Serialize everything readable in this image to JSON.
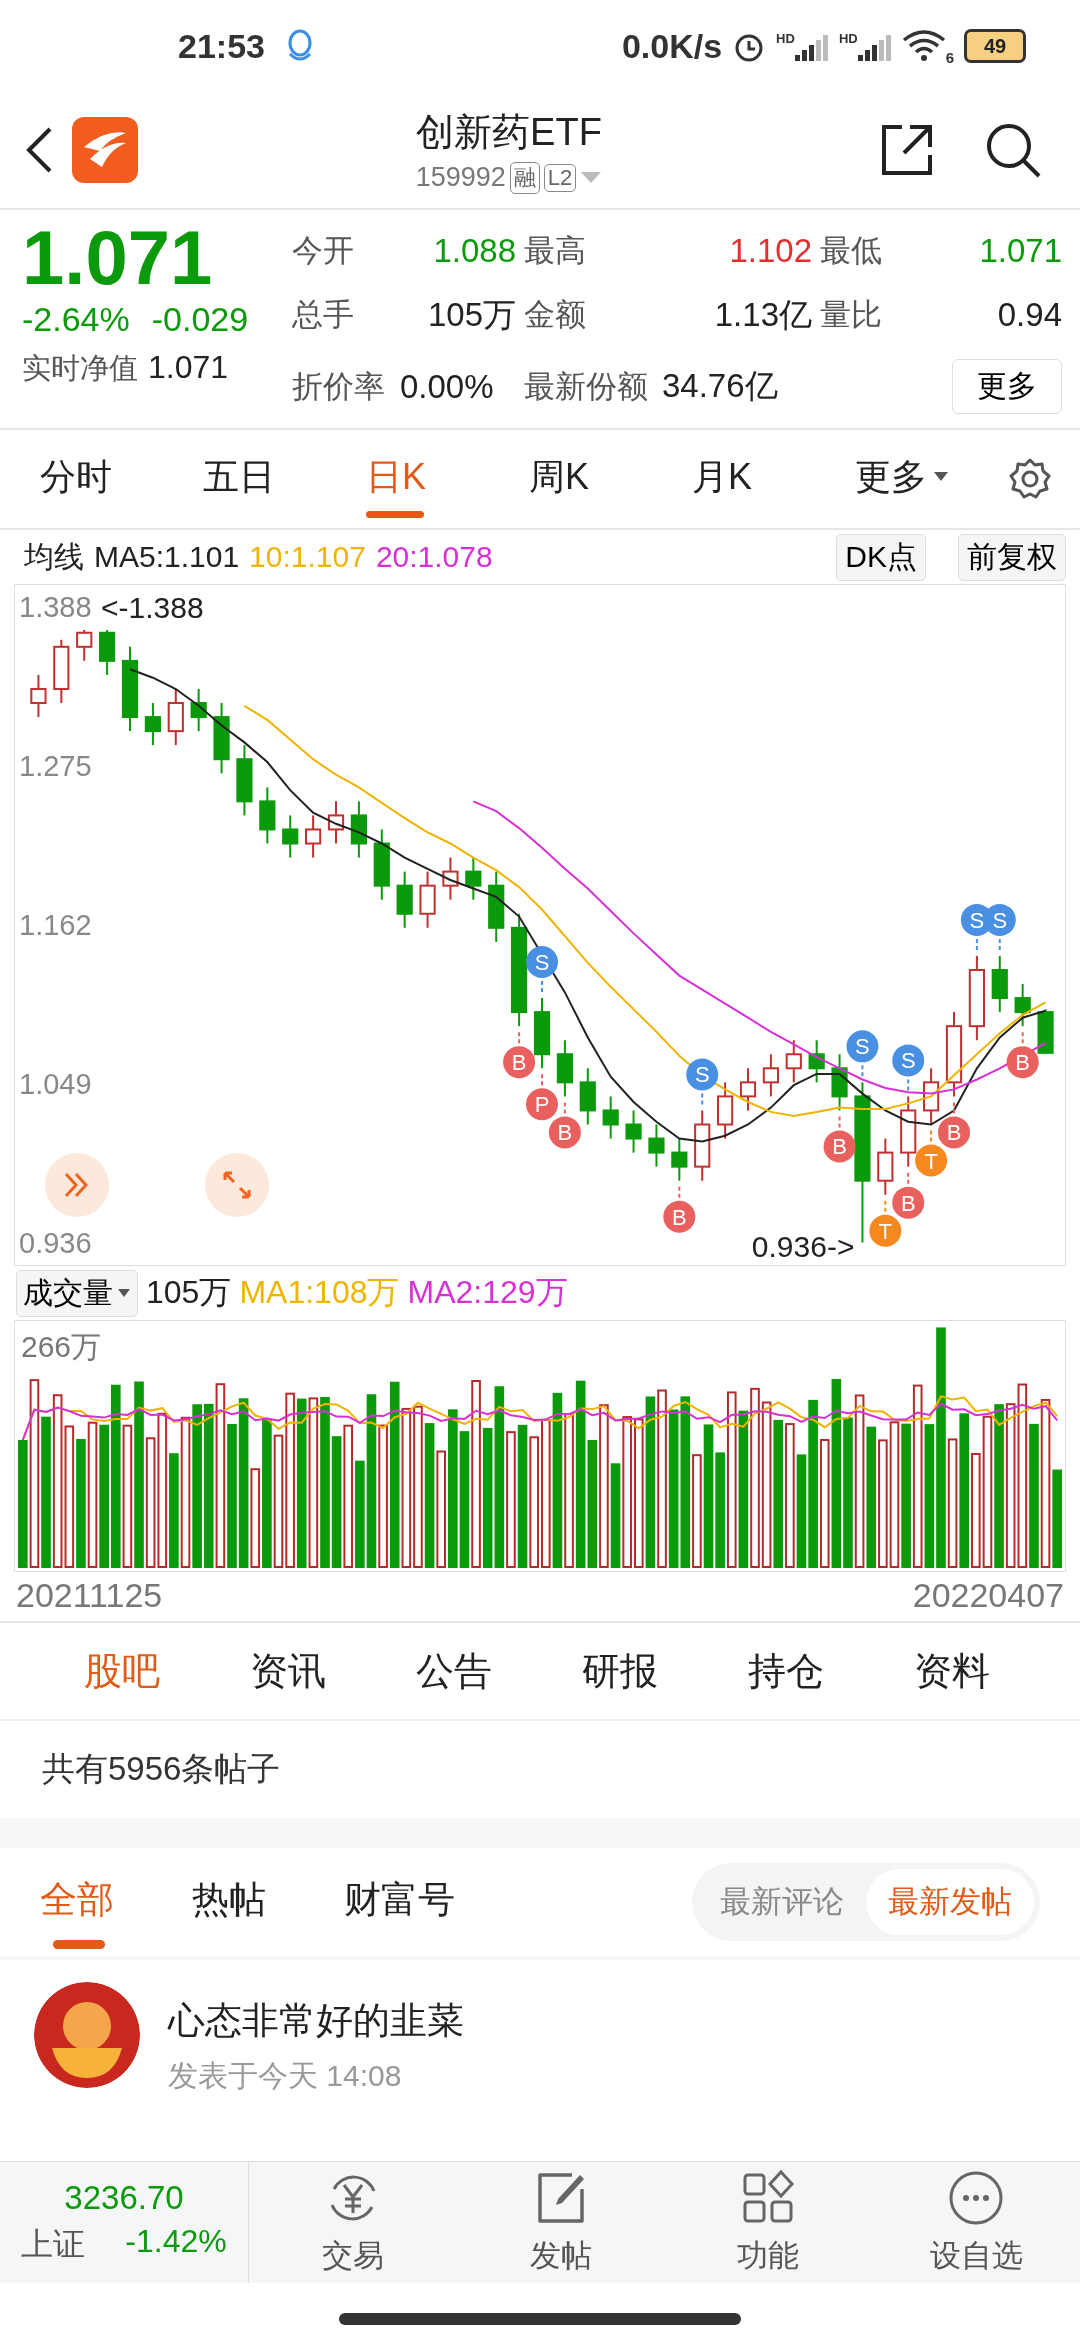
{
  "status_bar": {
    "time": "21:53",
    "net_speed": "0.0K/s",
    "signal_labels": [
      "HD",
      "HD"
    ],
    "wifi_label": "6",
    "battery": "49"
  },
  "header": {
    "title": "创新药ETF",
    "code": "159992",
    "badges": [
      "融",
      "L2"
    ]
  },
  "quote": {
    "price": "1.071",
    "color": "#0b9a0b",
    "change_pct": "-2.64%",
    "change": "-0.029",
    "nav_label": "实时净值",
    "nav": "1.071",
    "more": "更多",
    "stats": [
      {
        "label": "今开",
        "value": "1.088",
        "color": "#0b9a0b"
      },
      {
        "label": "最高",
        "value": "1.102",
        "color": "#e0302f"
      },
      {
        "label": "最低",
        "value": "1.071",
        "color": "#0b9a0b"
      },
      {
        "label": "总手",
        "value": "105万",
        "color": "#222222"
      },
      {
        "label": "金额",
        "value": "1.13亿",
        "color": "#222222"
      },
      {
        "label": "量比",
        "value": "0.94",
        "color": "#222222"
      },
      {
        "label": "折价率",
        "value": "0.00%",
        "color": "#222222"
      },
      {
        "label": "最新份额",
        "value": "34.76亿",
        "color": "#222222"
      }
    ]
  },
  "period_tabs": [
    {
      "label": "分时",
      "selected": false,
      "kind": "tab"
    },
    {
      "label": "五日",
      "selected": false,
      "kind": "tab"
    },
    {
      "label": "日K",
      "selected": true,
      "kind": "tab"
    },
    {
      "label": "周K",
      "selected": false,
      "kind": "tab"
    },
    {
      "label": "月K",
      "selected": false,
      "kind": "tab"
    },
    {
      "label": "更多",
      "selected": false,
      "kind": "dropdown"
    }
  ],
  "ma_legend": {
    "label": "均线",
    "items": [
      {
        "text": "MA5:1.101",
        "color": "#222222"
      },
      {
        "text": "10:1.107",
        "color": "#f0b400"
      },
      {
        "text": "20:1.078",
        "color": "#d630d6"
      }
    ],
    "buttons": [
      "DK点",
      "前复权"
    ]
  },
  "price_chart": {
    "max_label": "<-1.388",
    "min_label": "0.936->",
    "markers": [
      {
        "letter": "S",
        "kind": "sell"
      },
      {
        "letter": "B",
        "kind": "buy"
      },
      {
        "letter": "P",
        "kind": "buy"
      },
      {
        "letter": "B",
        "kind": "buy"
      },
      {
        "letter": "S",
        "kind": "sell"
      },
      {
        "letter": "B",
        "kind": "buy"
      },
      {
        "letter": "S",
        "kind": "sell"
      },
      {
        "letter": "B",
        "kind": "buy"
      },
      {
        "letter": "T",
        "kind": "t"
      },
      {
        "letter": "S",
        "kind": "sell"
      },
      {
        "letter": "B",
        "kind": "buy"
      },
      {
        "letter": "T",
        "kind": "t"
      },
      {
        "letter": "B",
        "kind": "buy"
      },
      {
        "letter": "S",
        "kind": "sell"
      },
      {
        "letter": "S",
        "kind": "sell"
      },
      {
        "letter": "B",
        "kind": "buy"
      }
    ],
    "chart_data": {
      "type": "candlestick",
      "ylim": [
        0.92,
        1.404
      ],
      "yticks": [
        0.936,
        1.049,
        1.162,
        1.275,
        1.388
      ],
      "ohlc": [
        [
          1.32,
          1.34,
          1.31,
          1.33
        ],
        [
          1.33,
          1.365,
          1.32,
          1.36
        ],
        [
          1.36,
          1.372,
          1.35,
          1.37
        ],
        [
          1.37,
          1.372,
          1.34,
          1.35
        ],
        [
          1.35,
          1.36,
          1.3,
          1.31
        ],
        [
          1.31,
          1.32,
          1.29,
          1.3
        ],
        [
          1.3,
          1.33,
          1.29,
          1.32
        ],
        [
          1.32,
          1.33,
          1.3,
          1.31
        ],
        [
          1.31,
          1.32,
          1.27,
          1.28
        ],
        [
          1.28,
          1.29,
          1.24,
          1.25
        ],
        [
          1.25,
          1.26,
          1.22,
          1.23
        ],
        [
          1.23,
          1.24,
          1.21,
          1.22
        ],
        [
          1.22,
          1.24,
          1.21,
          1.23
        ],
        [
          1.23,
          1.25,
          1.22,
          1.24
        ],
        [
          1.24,
          1.25,
          1.21,
          1.22
        ],
        [
          1.22,
          1.23,
          1.18,
          1.19
        ],
        [
          1.19,
          1.2,
          1.16,
          1.17
        ],
        [
          1.17,
          1.2,
          1.16,
          1.19
        ],
        [
          1.19,
          1.21,
          1.18,
          1.2
        ],
        [
          1.2,
          1.21,
          1.18,
          1.19
        ],
        [
          1.19,
          1.2,
          1.15,
          1.16
        ],
        [
          1.16,
          1.17,
          1.09,
          1.1
        ],
        [
          1.1,
          1.11,
          1.06,
          1.07
        ],
        [
          1.07,
          1.08,
          1.04,
          1.05
        ],
        [
          1.05,
          1.06,
          1.02,
          1.03
        ],
        [
          1.03,
          1.04,
          1.01,
          1.02
        ],
        [
          1.02,
          1.03,
          1.0,
          1.01
        ],
        [
          1.01,
          1.02,
          0.99,
          1.0
        ],
        [
          1.0,
          1.01,
          0.98,
          0.99
        ],
        [
          0.99,
          1.03,
          0.98,
          1.02
        ],
        [
          1.02,
          1.05,
          1.01,
          1.04
        ],
        [
          1.04,
          1.06,
          1.03,
          1.05
        ],
        [
          1.05,
          1.07,
          1.04,
          1.06
        ],
        [
          1.06,
          1.08,
          1.05,
          1.07
        ],
        [
          1.07,
          1.08,
          1.05,
          1.06
        ],
        [
          1.06,
          1.07,
          1.03,
          1.04
        ],
        [
          1.04,
          1.05,
          0.936,
          0.98
        ],
        [
          0.98,
          1.01,
          0.97,
          1.0
        ],
        [
          1.0,
          1.04,
          0.99,
          1.03
        ],
        [
          1.03,
          1.06,
          1.02,
          1.05
        ],
        [
          1.05,
          1.1,
          1.04,
          1.09
        ],
        [
          1.09,
          1.14,
          1.08,
          1.13
        ],
        [
          1.13,
          1.14,
          1.1,
          1.11
        ],
        [
          1.11,
          1.12,
          1.09,
          1.1
        ],
        [
          1.1,
          1.102,
          1.071,
          1.071
        ]
      ],
      "series": [
        {
          "type": "line",
          "color": "#222222",
          "values": [
            null,
            null,
            null,
            null,
            1.344,
            1.338,
            1.33,
            1.318,
            1.304,
            1.292,
            1.278,
            1.258,
            1.242,
            1.234,
            1.228,
            1.22,
            1.21,
            1.202,
            1.194,
            1.188,
            1.182,
            1.168,
            null,
            1.114,
            1.082,
            1.054,
            1.036,
            1.022,
            1.01,
            1.008,
            1.012,
            1.02,
            1.032,
            1.048,
            1.056,
            1.056,
            1.042,
            1.03,
            1.022,
            1.02,
            1.03,
            1.06,
            1.082,
            1.096,
            1.101
          ]
        },
        {
          "type": "line",
          "color": "#f0b400",
          "values": [
            null,
            null,
            null,
            null,
            null,
            null,
            null,
            null,
            null,
            1.318,
            1.308,
            1.294,
            1.28,
            1.269,
            1.26,
            1.249,
            1.238,
            1.228,
            1.22,
            1.21,
            1.201,
            1.189,
            1.173,
            1.154,
            1.135,
            1.118,
            1.102,
            1.086,
            1.069,
            1.055,
            1.045,
            1.036,
            1.029,
            1.026,
            1.029,
            1.032,
            1.031,
            1.031,
            1.035,
            1.04,
            1.055,
            1.07,
            1.085,
            1.098,
            1.107
          ]
        },
        {
          "type": "line",
          "color": "#d630d6",
          "values": [
            null,
            null,
            null,
            null,
            null,
            null,
            null,
            null,
            null,
            null,
            null,
            null,
            null,
            null,
            null,
            null,
            null,
            null,
            null,
            1.25,
            1.243,
            1.231,
            1.217,
            1.202,
            1.188,
            1.172,
            1.156,
            1.141,
            1.126,
            1.116,
            1.106,
            1.096,
            1.086,
            1.077,
            1.068,
            1.06,
            1.052,
            1.046,
            1.043,
            1.042,
            1.045,
            1.052,
            1.06,
            null,
            1.078
          ]
        }
      ]
    }
  },
  "volume": {
    "selector": "成交量",
    "value": "105万",
    "ma": [
      {
        "text": "MA1:108万",
        "color": "#f0b400"
      },
      {
        "text": "MA2:129万",
        "color": "#d630d6"
      }
    ],
    "top_label": "266万",
    "start_date": "20211125",
    "end_date": "20220407"
  },
  "info_tabs": [
    {
      "label": "股吧",
      "selected": true
    },
    {
      "label": "资讯",
      "selected": false
    },
    {
      "label": "公告",
      "selected": false
    },
    {
      "label": "研报",
      "selected": false
    },
    {
      "label": "持仓",
      "selected": false
    },
    {
      "label": "资料",
      "selected": false
    }
  ],
  "post_count": "共有5956条帖子",
  "post_tabs": [
    {
      "label": "全部",
      "selected": true
    },
    {
      "label": "热帖",
      "selected": false
    },
    {
      "label": "财富号",
      "selected": false
    }
  ],
  "sort_options": [
    {
      "label": "最新评论",
      "selected": false
    },
    {
      "label": "最新发帖",
      "selected": true
    }
  ],
  "posts": [
    {
      "author": "心态非常好的韭菜",
      "time": "发表于今天 14:08"
    }
  ],
  "bottom_bar": {
    "index": {
      "value": "3236.70",
      "name": "上证",
      "change": "-1.42%",
      "color": "#0b9a0b"
    },
    "actions": [
      {
        "label": "交易",
        "kind": "trade"
      },
      {
        "label": "发帖",
        "kind": "post"
      },
      {
        "label": "功能",
        "kind": "apps"
      },
      {
        "label": "设自选",
        "kind": "more"
      }
    ]
  }
}
